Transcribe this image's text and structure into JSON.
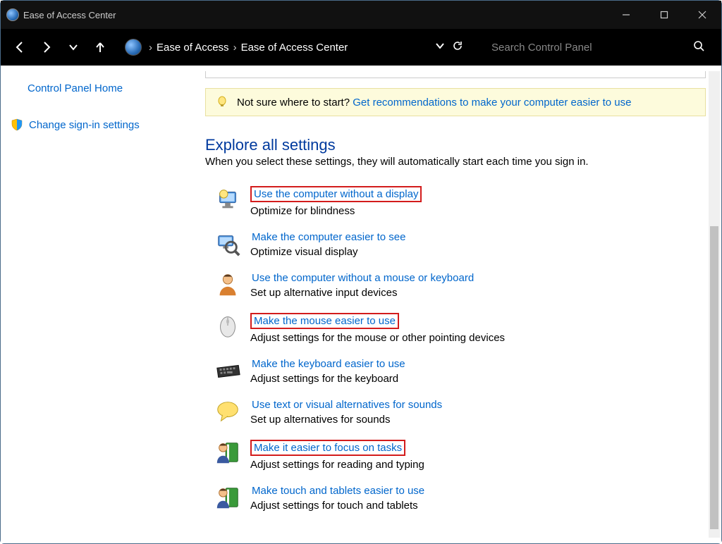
{
  "window": {
    "title": "Ease of Access Center"
  },
  "breadcrumb": {
    "part1": "Ease of Access",
    "part2": "Ease of Access Center"
  },
  "search": {
    "placeholder": "Search Control Panel"
  },
  "sidebar": {
    "home": "Control Panel Home",
    "change_signin": "Change sign-in settings"
  },
  "hint": {
    "prefix": "Not sure where to start? ",
    "link": "Get recommendations to make your computer easier to use"
  },
  "explore": {
    "title": "Explore all settings",
    "subtitle": "When you select these settings, they will automatically start each time you sign in."
  },
  "settings": [
    {
      "link": "Use the computer without a display",
      "desc": "Optimize for blindness",
      "highlighted": true,
      "icon": "display"
    },
    {
      "link": "Make the computer easier to see",
      "desc": "Optimize visual display",
      "highlighted": false,
      "icon": "magnifier"
    },
    {
      "link": "Use the computer without a mouse or keyboard",
      "desc": "Set up alternative input devices",
      "highlighted": false,
      "icon": "person"
    },
    {
      "link": "Make the mouse easier to use",
      "desc": "Adjust settings for the mouse or other pointing devices",
      "highlighted": true,
      "icon": "mouse"
    },
    {
      "link": "Make the keyboard easier to use",
      "desc": "Adjust settings for the keyboard",
      "highlighted": false,
      "icon": "keyboard"
    },
    {
      "link": "Use text or visual alternatives for sounds",
      "desc": "Set up alternatives for sounds",
      "highlighted": false,
      "icon": "speech"
    },
    {
      "link": "Make it easier to focus on tasks",
      "desc": "Adjust settings for reading and typing",
      "highlighted": true,
      "icon": "personbook"
    },
    {
      "link": "Make touch and tablets easier to use",
      "desc": "Adjust settings for touch and tablets",
      "highlighted": false,
      "icon": "personbook"
    }
  ]
}
